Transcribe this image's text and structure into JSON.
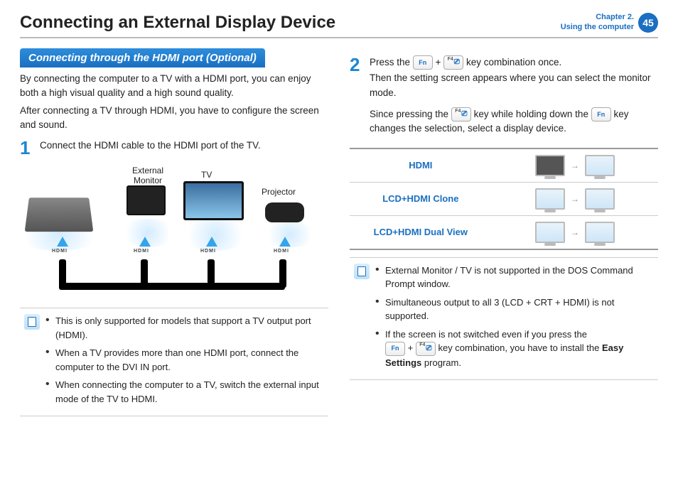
{
  "header": {
    "title": "Connecting an External Display Device",
    "chapter_line1": "Chapter 2.",
    "chapter_line2": "Using the computer",
    "page_number": "45"
  },
  "left": {
    "section_heading": "Connecting through the HDMI port (Optional)",
    "intro1": "By connecting the computer to a TV with a HDMI port, you can enjoy both a high visual quality and a high sound quality.",
    "intro2": "After connecting a TV through HDMI, you have to configure the screen and sound.",
    "step1_num": "1",
    "step1_text": "Connect the HDMI cable to the HDMI port of the TV.",
    "diagram_labels": {
      "external_monitor": "External Monitor",
      "tv": "TV",
      "projector": "Projector",
      "hdmi": "HDMI"
    },
    "notes": [
      "This is only supported for models that support a TV output port (HDMI).",
      "When a TV provides more than one HDMI port, connect the computer to the DVI IN port.",
      "When connecting the computer to a TV, switch the external input mode of the TV to HDMI."
    ]
  },
  "right": {
    "step2_num": "2",
    "step2_line1a": "Press the ",
    "step2_line1b": " key combination once.",
    "step2_line2": "Then the setting screen appears where you can select the monitor mode.",
    "step2_line3a": "Since pressing the ",
    "step2_line3b": " key while holding down the ",
    "step2_line3c": " key changes the selection, select a display device.",
    "key_fn": "Fn",
    "key_f4": "F4",
    "plus": "+",
    "table": {
      "modes": [
        "HDMI",
        "LCD+HDMI Clone",
        "LCD+HDMI Dual View"
      ]
    },
    "notes": {
      "n1": "External Monitor / TV is not supported in the DOS Command Prompt window.",
      "n2": "Simultaneous output to all 3 (LCD + CRT + HDMI) is not supported.",
      "n3a": "If the screen is not switched even if you press the",
      "n3b": " key combination, you have to install the ",
      "n3c": "Easy Settings",
      "n3d": " program."
    }
  }
}
